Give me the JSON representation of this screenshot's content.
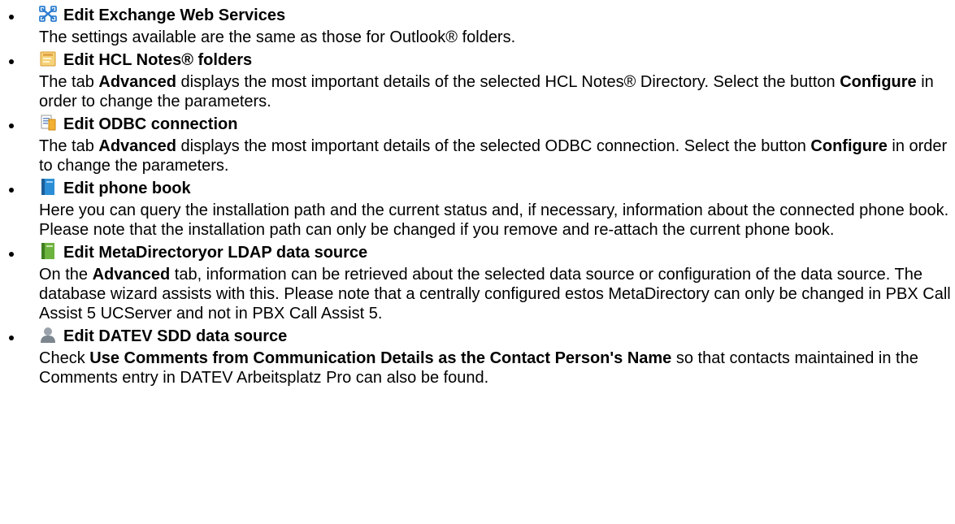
{
  "items": [
    {
      "icon": "exchange-web-services-icon",
      "title": "Edit Exchange Web Services",
      "desc": [
        {
          "t": "The settings available are the same as those for Outlook® folders.",
          "b": false
        }
      ]
    },
    {
      "icon": "notes-folder-icon",
      "title": "Edit HCL Notes® folders",
      "desc": [
        {
          "t": "The tab ",
          "b": false
        },
        {
          "t": "Advanced",
          "b": true
        },
        {
          "t": " displays the most important details of the selected HCL Notes® Directory. Select the button ",
          "b": false
        },
        {
          "t": "Configure",
          "b": true
        },
        {
          "t": " in order to change the parameters.",
          "b": false
        }
      ]
    },
    {
      "icon": "odbc-connection-icon",
      "title": "Edit ODBC connection",
      "desc": [
        {
          "t": "The tab ",
          "b": false
        },
        {
          "t": "Advanced",
          "b": true
        },
        {
          "t": " displays the most important details of the selected ODBC connection. Select the button ",
          "b": false
        },
        {
          "t": "Configure",
          "b": true
        },
        {
          "t": " in order to change the parameters.",
          "b": false
        }
      ]
    },
    {
      "icon": "phone-book-icon",
      "title": "Edit phone book",
      "desc": [
        {
          "t": "Here you can query the installation path and the current status and, if necessary, information about the connected phone book. Please note that the installation path can only be changed if you remove and re-attach the current phone book.",
          "b": false
        }
      ]
    },
    {
      "icon": "metadirectory-ldap-icon",
      "title": "Edit MetaDirectoryor LDAP data source",
      "desc": [
        {
          "t": "On the ",
          "b": false
        },
        {
          "t": "Advanced",
          "b": true
        },
        {
          "t": " tab, information can be retrieved about the selected data source or configuration of the data source. The database wizard assists with this. Please note that a centrally configured estos MetaDirectory can only be changed in PBX Call Assist 5 UCServer and not in PBX Call Assist 5.",
          "b": false
        }
      ]
    },
    {
      "icon": "datev-person-icon",
      "title": "Edit DATEV SDD data source",
      "desc": [
        {
          "t": "Check ",
          "b": false
        },
        {
          "t": "Use Comments from Communication Details as the Contact Person's Name",
          "b": true
        },
        {
          "t": " so that contacts maintained in the Comments entry in DATEV Arbeitsplatz Pro can also be found.",
          "b": false
        }
      ]
    }
  ]
}
